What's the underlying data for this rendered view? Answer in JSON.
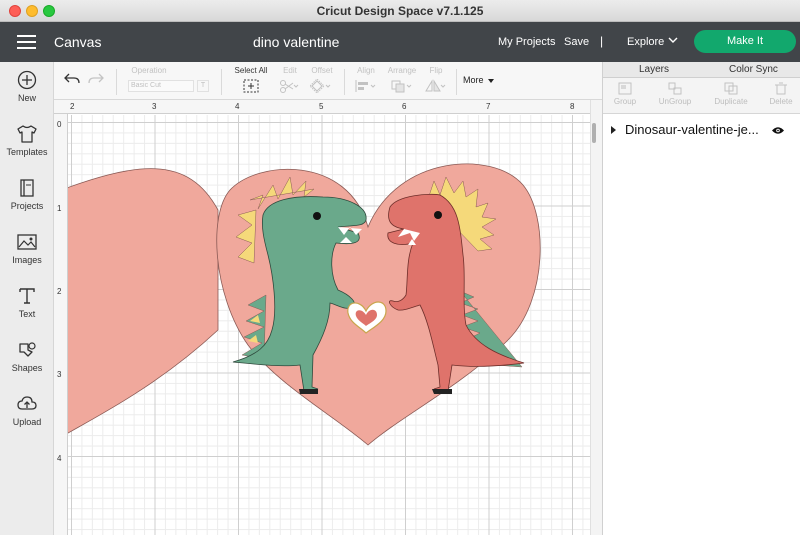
{
  "window": {
    "title": "Cricut Design Space  v7.1.125"
  },
  "header": {
    "canvas_label": "Canvas",
    "project_name": "dino valentine",
    "my_projects": "My Projects",
    "save": "Save",
    "separator": "|",
    "explore": "Explore",
    "make_it": "Make It",
    "accent_color": "#12a86d"
  },
  "sidebar": {
    "items": [
      {
        "label": "New",
        "icon": "plus-circle-icon"
      },
      {
        "label": "Templates",
        "icon": "shirt-icon"
      },
      {
        "label": "Projects",
        "icon": "book-icon"
      },
      {
        "label": "Images",
        "icon": "image-icon"
      },
      {
        "label": "Text",
        "icon": "text-t-icon"
      },
      {
        "label": "Shapes",
        "icon": "shapes-icon"
      },
      {
        "label": "Upload",
        "icon": "cloud-upload-icon"
      }
    ]
  },
  "toolbar": {
    "operation_label": "Operation",
    "operation_value": "Basic Cut",
    "select_all": "Select All",
    "edit": "Edit",
    "offset": "Offset",
    "align": "Align",
    "arrange": "Arrange",
    "flip": "Flip",
    "more": "More"
  },
  "ruler": {
    "horizontal": [
      "2",
      "3",
      "4",
      "5",
      "6",
      "7",
      "8"
    ],
    "vertical": [
      "0",
      "1",
      "2",
      "3",
      "4"
    ]
  },
  "layers_panel": {
    "tabs": [
      "Layers",
      "Color Sync"
    ],
    "tools": [
      "Group",
      "UnGroup",
      "Duplicate",
      "Delete"
    ],
    "layers": [
      {
        "name": "Dinosaur-valentine-je..."
      }
    ]
  },
  "colors": {
    "heart": "#f0a89c",
    "heart_outline": "#8a5a55",
    "dino_green": "#6aa98b",
    "dino_red": "#df736b",
    "spike_yellow": "#f5d97a"
  }
}
